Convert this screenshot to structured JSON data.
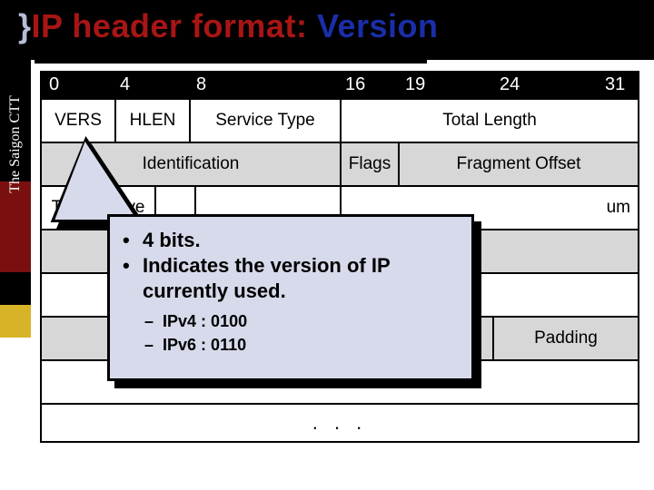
{
  "sidebar": {
    "label": "The Saigon CTT"
  },
  "title": {
    "prefix": "}",
    "main": "IP header format: ",
    "accent": "Version"
  },
  "ruler": {
    "b0": "0",
    "b4": "4",
    "b8": "8",
    "b16": "16",
    "b19": "19",
    "b24": "24",
    "b31": "31"
  },
  "rows": {
    "r1": {
      "c1": "VERS",
      "c2": "HLEN",
      "c3": "Service Type",
      "c4": "Total Length"
    },
    "r2": {
      "c1": "Identification",
      "c2": "Flags",
      "c3": "Fragment  Offset"
    },
    "r3": {
      "c1": "Time to Live",
      "c4_suffix": "um"
    },
    "r6": {
      "c_right": "Padding"
    },
    "dots": ". . ."
  },
  "callout": {
    "b1": "4 bits.",
    "b2": "Indicates the version of IP currently used.",
    "s1": "IPv4 : 0100",
    "s2": "IPv6 : 0110",
    "bullet_main": "•",
    "bullet_sub": "–"
  }
}
